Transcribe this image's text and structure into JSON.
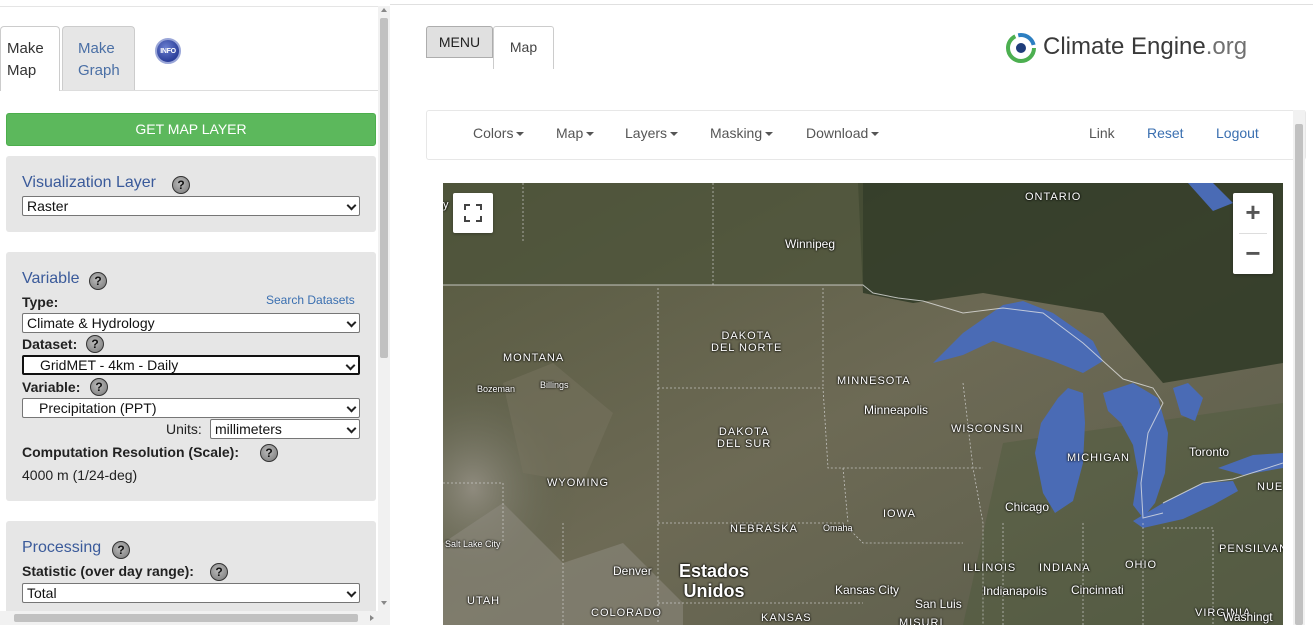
{
  "left_panel": {
    "tabs": {
      "make_map": "Make Map",
      "make_graph": "Make Graph"
    },
    "info_icon_text": "INFO",
    "get_map_layer": "GET MAP LAYER",
    "visualization": {
      "title": "Visualization Layer",
      "help": "?",
      "layer_value": "Raster"
    },
    "variable": {
      "title": "Variable",
      "help": "?",
      "type_label": "Type:",
      "search_datasets": "Search Datasets",
      "type_value": "Climate & Hydrology",
      "dataset_label": "Dataset:",
      "dataset_value": "GridMET - 4km - Daily",
      "variable_label": "Variable:",
      "variable_value": "Precipitation (PPT)",
      "units_label": "Units:",
      "units_value": "millimeters",
      "resolution_label": "Computation Resolution (Scale):",
      "resolution_value": "4000 m (1/24-deg)"
    },
    "processing": {
      "title": "Processing",
      "help": "?",
      "statistic_label": "Statistic (over day range):",
      "statistic_value": "Total"
    }
  },
  "header": {
    "menu_button": "MENU",
    "map_tab": "Map",
    "logo": {
      "name": "Climate Engine",
      "suffix": ".org"
    }
  },
  "navbar": {
    "dropdowns": [
      "Colors",
      "Map",
      "Layers",
      "Masking",
      "Download"
    ],
    "links": [
      "Link",
      "Reset",
      "Logout"
    ]
  },
  "map": {
    "controls": {
      "zoom_in": "+",
      "zoom_out": "−"
    },
    "labels": {
      "ontario": "ONTARIO",
      "winnipeg": "Winnipeg",
      "north_dakota": "DAKOTA\nDEL NORTE",
      "montana": "MONTANA",
      "bozeman": "Bozeman",
      "billings": "Billings",
      "minnesota": "MINNESOTA",
      "minneapolis": "Minneapolis",
      "wisconsin": "WISCONSIN",
      "michigan": "MICHIGAN",
      "toronto": "Toronto",
      "nue": "NUE",
      "south_dakota": "DAKOTA\nDEL SUR",
      "wyoming": "WYOMING",
      "chicago": "Chicago",
      "iowa": "IOWA",
      "nebraska": "NEBRASKA",
      "omaha": "Omaha",
      "salt_lake_city": "Salt Lake City",
      "denver": "Denver",
      "estados_unidos": "Estados\nUnidos",
      "illinois": "ILLINOIS",
      "indiana": "INDIANA",
      "ohio": "OHIO",
      "pennsylvania": "PENSILVAN",
      "kansas_city": "Kansas City",
      "indianapolis": "Indianapolis",
      "cincinnati": "Cincinnati",
      "utah": "UTAH",
      "colorado": "COLORADO",
      "kansas": "KANSAS",
      "st_louis": "San Luis",
      "missouri": "MISURI",
      "virginia": "VIRGINIA",
      "washington": "Washingt",
      "cut_label": "y"
    }
  },
  "colors": {
    "accent_green": "#5cb85c",
    "title_blue": "#3a5a9a",
    "link_blue": "#3a6fb0",
    "lake_blue": "#4a6bb5"
  }
}
